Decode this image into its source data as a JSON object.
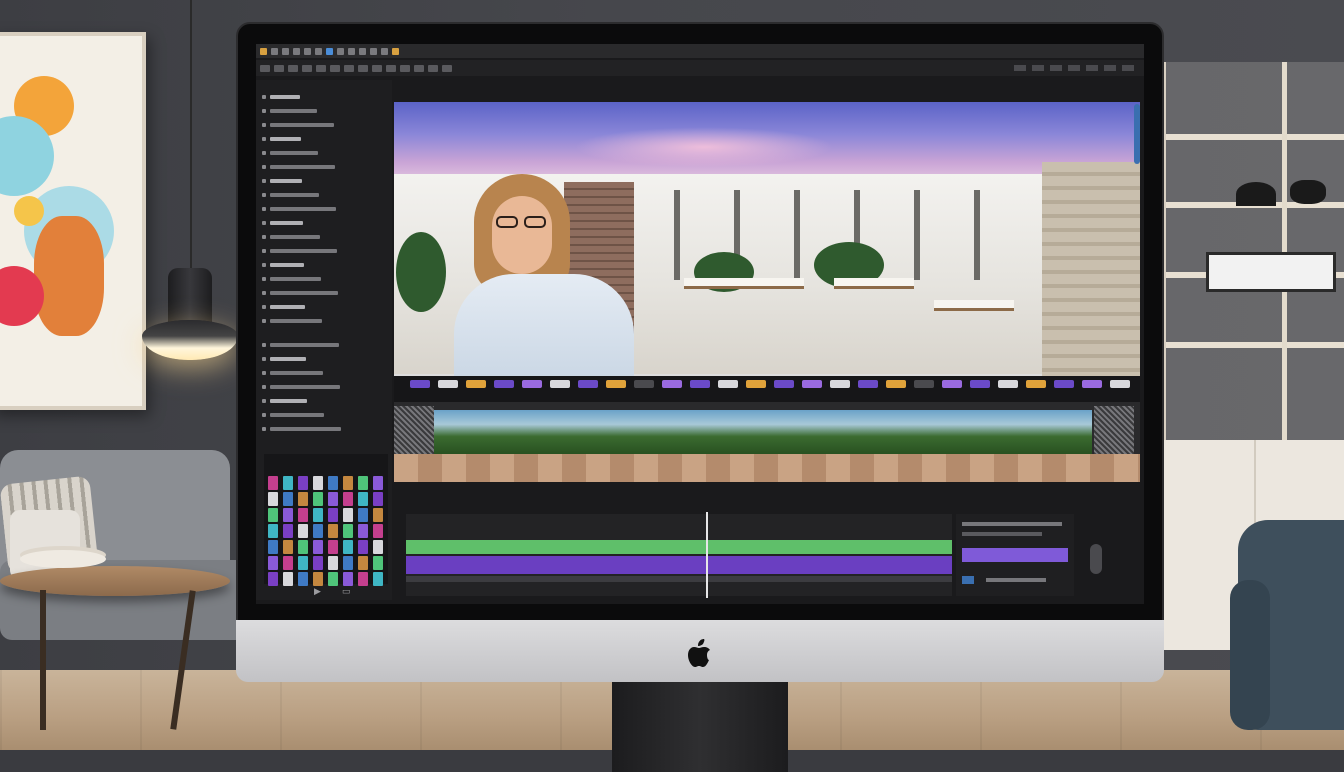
{
  "app": {
    "menu_title": "",
    "panel_labels": [
      "",
      ""
    ],
    "timeline_label": "",
    "timecode": ""
  },
  "icons": {
    "apple": "apple-logo-icon",
    "folder": "folder-icon",
    "play": "play-icon",
    "scroll": "scrollbar-icon"
  },
  "colors": {
    "track_green": "#5fbf6a",
    "track_purple": "#6a3fc1",
    "track_violet": "#7f5ad8",
    "accent_blue": "#3a6fb0"
  },
  "playhead_position": 0.55
}
